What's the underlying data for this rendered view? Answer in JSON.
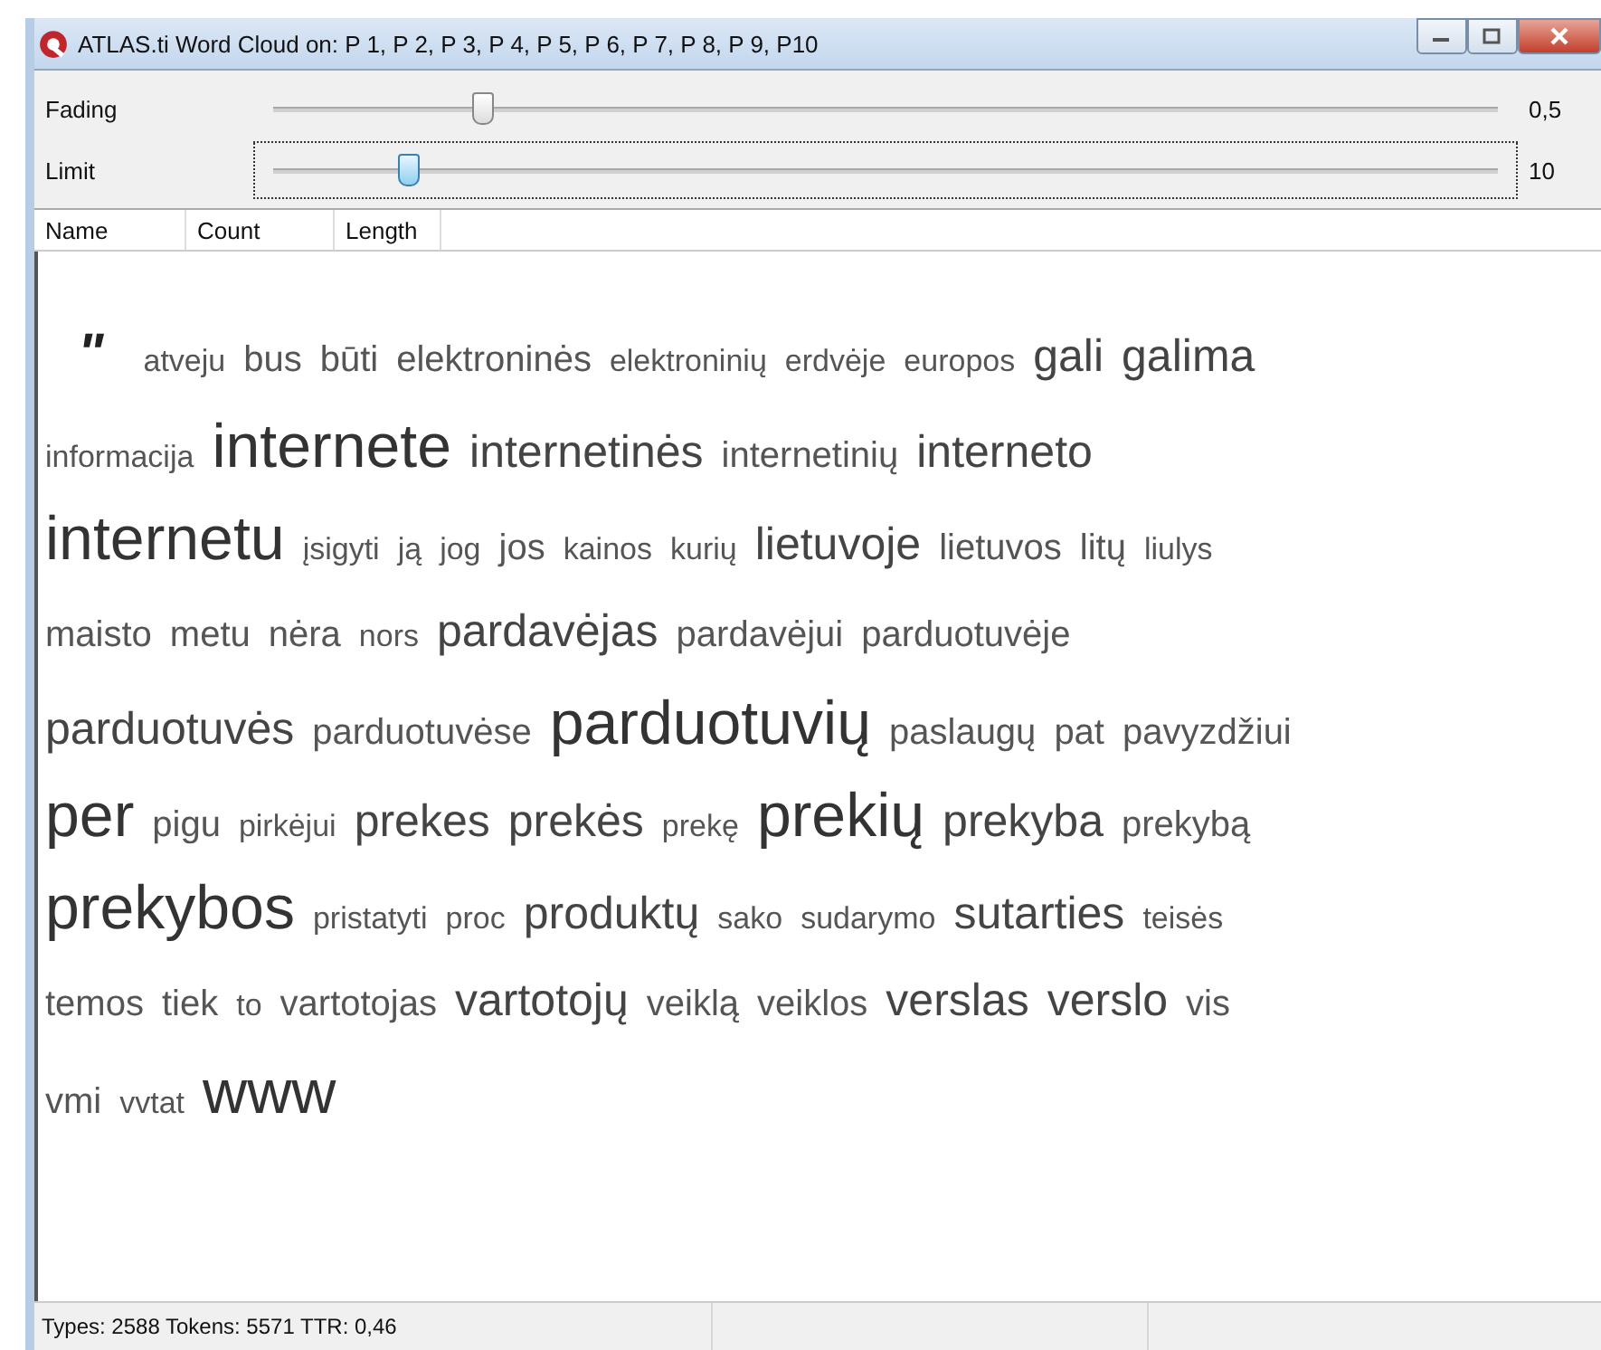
{
  "window": {
    "title": "ATLAS.ti Word Cloud on: P 1, P 2, P 3, P 4, P 5, P 6, P 7, P 8, P 9, P10"
  },
  "sliders": [
    {
      "label": "Fading",
      "level": 0.17,
      "reading": "0,5",
      "focused": false
    },
    {
      "label": "Limit",
      "level": 0.11,
      "reading": "10",
      "focused": true
    }
  ],
  "columns": [
    "Name",
    "Count",
    "Length"
  ],
  "lines": [
    [
      {
        "text": "\"",
        "kind": "quote"
      },
      {
        "text": "atveju",
        "kind": "s"
      },
      {
        "text": "bus",
        "kind": "m"
      },
      {
        "text": "būti",
        "kind": "m"
      },
      {
        "text": "elektroninės",
        "kind": "m"
      },
      {
        "text": "elektroninių",
        "kind": "s"
      },
      {
        "text": "erdvėje",
        "kind": "s"
      },
      {
        "text": "europos",
        "kind": "s"
      },
      {
        "text": "gali",
        "kind": "l"
      },
      {
        "text": "galima",
        "kind": "l"
      }
    ],
    [
      {
        "text": "informacija",
        "kind": "s"
      },
      {
        "text": "internete",
        "kind": "xl"
      },
      {
        "text": "internetinės",
        "kind": "l"
      },
      {
        "text": "internetinių",
        "kind": "m"
      },
      {
        "text": "interneto",
        "kind": "l"
      }
    ],
    [
      {
        "text": "internetu",
        "kind": "xl"
      },
      {
        "text": "įsigyti",
        "kind": "s"
      },
      {
        "text": "ją",
        "kind": "s"
      },
      {
        "text": "jog",
        "kind": "s"
      },
      {
        "text": "jos",
        "kind": "m"
      },
      {
        "text": "kainos",
        "kind": "s"
      },
      {
        "text": "kurių",
        "kind": "s"
      },
      {
        "text": "lietuvoje",
        "kind": "l"
      },
      {
        "text": "lietuvos",
        "kind": "m"
      },
      {
        "text": "litų",
        "kind": "m"
      },
      {
        "text": "liulys",
        "kind": "s"
      }
    ],
    [
      {
        "text": "maisto",
        "kind": "m"
      },
      {
        "text": "metu",
        "kind": "m"
      },
      {
        "text": "nėra",
        "kind": "m"
      },
      {
        "text": "nors",
        "kind": "s"
      },
      {
        "text": "pardavėjas",
        "kind": "l"
      },
      {
        "text": "pardavėjui",
        "kind": "m"
      },
      {
        "text": "parduotuvėje",
        "kind": "m"
      }
    ],
    [
      {
        "text": "parduotuvės",
        "kind": "l"
      },
      {
        "text": "parduotuvėse",
        "kind": "m"
      },
      {
        "text": "parduotuvių",
        "kind": "xl"
      },
      {
        "text": "paslaugų",
        "kind": "m"
      },
      {
        "text": "pat",
        "kind": "m"
      },
      {
        "text": "pavyzdžiui",
        "kind": "m"
      }
    ],
    [
      {
        "text": "per",
        "kind": "xl"
      },
      {
        "text": "pigu",
        "kind": "m"
      },
      {
        "text": "pirkėjui",
        "kind": "s"
      },
      {
        "text": "prekes",
        "kind": "l"
      },
      {
        "text": "prekės",
        "kind": "l"
      },
      {
        "text": "prekę",
        "kind": "s"
      },
      {
        "text": "prekių",
        "kind": "xl"
      },
      {
        "text": "prekyba",
        "kind": "l"
      },
      {
        "text": "prekybą",
        "kind": "m"
      }
    ],
    [
      {
        "text": "prekybos",
        "kind": "xl"
      },
      {
        "text": "pristatyti",
        "kind": "s"
      },
      {
        "text": "proc",
        "kind": "s"
      },
      {
        "text": "produktų",
        "kind": "l"
      },
      {
        "text": "sako",
        "kind": "s"
      },
      {
        "text": "sudarymo",
        "kind": "s"
      },
      {
        "text": "sutarties",
        "kind": "l"
      },
      {
        "text": "teisės",
        "kind": "s"
      }
    ],
    [
      {
        "text": "temos",
        "kind": "m"
      },
      {
        "text": "tiek",
        "kind": "m"
      },
      {
        "text": "to",
        "kind": "s"
      },
      {
        "text": "vartotojas",
        "kind": "m"
      },
      {
        "text": "vartotojų",
        "kind": "l"
      },
      {
        "text": "veiklą",
        "kind": "m"
      },
      {
        "text": "veiklos",
        "kind": "m"
      },
      {
        "text": "verslas",
        "kind": "l"
      },
      {
        "text": "verslo",
        "kind": "l"
      },
      {
        "text": "vis",
        "kind": "m"
      }
    ],
    [
      {
        "text": "vmi",
        "kind": "m"
      },
      {
        "text": "vvtat",
        "kind": "s"
      },
      {
        "text": "www",
        "kind": "xl"
      }
    ]
  ],
  "status_bar": "Types: 2588  Tokens: 5571  TTR: 0,46"
}
